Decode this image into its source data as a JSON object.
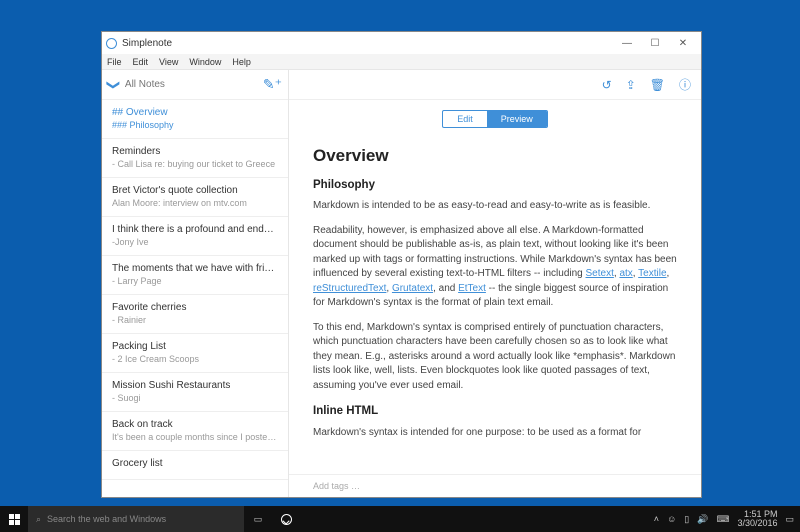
{
  "titlebar": {
    "title": "Simplenote"
  },
  "menubar": [
    "File",
    "Edit",
    "View",
    "Window",
    "Help"
  ],
  "sidebar": {
    "search_placeholder": "All Notes",
    "notes": [
      {
        "title": "## Overview",
        "sub": "### Philosophy",
        "active": true
      },
      {
        "title": "Reminders",
        "sub": "- Call Lisa re: buying our ticket to Greece"
      },
      {
        "title": "Bret Victor's quote collection",
        "sub": "Alan Moore: interview on mtv.com"
      },
      {
        "title": "I think there is a profound and enduri…",
        "sub": "-Jony Ive"
      },
      {
        "title": "The moments that we have with friend…",
        "sub": "- Larry Page"
      },
      {
        "title": "Favorite cherries",
        "sub": "- Rainier"
      },
      {
        "title": "Packing List",
        "sub": "- 2 Ice Cream Scoops"
      },
      {
        "title": "Mission Sushi Restaurants",
        "sub": "- Suogi"
      },
      {
        "title": "Back on track",
        "sub": "It's been a couple months since I posted on …"
      },
      {
        "title": "Grocery list",
        "sub": ""
      }
    ]
  },
  "toggle": {
    "edit": "Edit",
    "preview": "Preview"
  },
  "doc": {
    "h1": "Overview",
    "h2a": "Philosophy",
    "p1": "Markdown is intended to be as easy-to-read and easy-to-write as is feasible.",
    "p2a": "Readability, however, is emphasized above all else. A Markdown-formatted document should be publishable as-is, as plain text, without looking like it's been marked up with tags or formatting instructions. While Markdown's syntax has been influenced by several existing text-to-HTML filters -- including ",
    "links": {
      "l1": "Setext",
      "l2": "atx",
      "l3": "Textile",
      "l4": "reStructuredText",
      "l5": "Grutatext",
      "l6": "EtText"
    },
    "p2b": " -- the single biggest source of inspiration for Markdown's syntax is the format of plain text email.",
    "p3": "To this end, Markdown's syntax is comprised entirely of punctuation characters, which punctuation characters have been carefully chosen so as to look like what they mean. E.g., asterisks around a word actually look like *emphasis*. Markdown lists look like, well, lists. Even blockquotes look like quoted passages of text, assuming you've ever used email.",
    "h2b": "Inline HTML",
    "p4": "Markdown's syntax is intended for one purpose: to be used as a format for"
  },
  "tags_placeholder": "Add tags …",
  "taskbar": {
    "search": "Search the web and Windows",
    "time": "1:51 PM",
    "date": "3/30/2016"
  }
}
